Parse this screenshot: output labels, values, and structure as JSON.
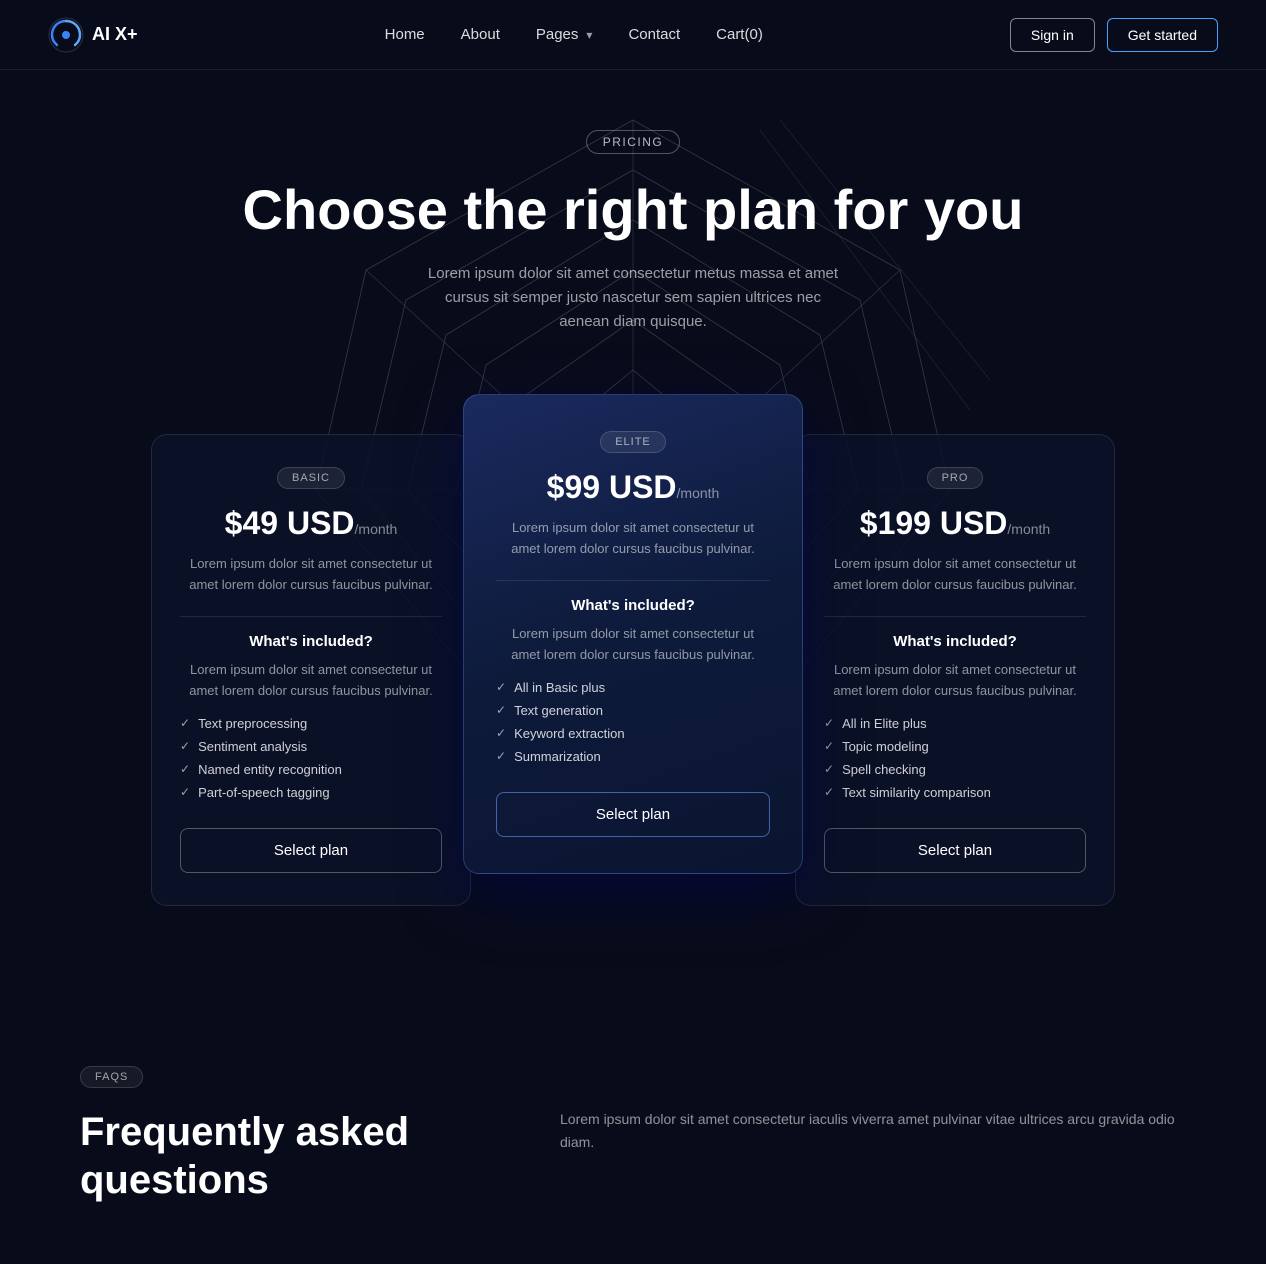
{
  "nav": {
    "logo_text": "AI X+",
    "links": [
      {
        "label": "Home",
        "id": "home"
      },
      {
        "label": "About",
        "id": "about"
      },
      {
        "label": "Pages",
        "id": "pages",
        "has_dropdown": true
      },
      {
        "label": "Contact",
        "id": "contact"
      },
      {
        "label": "Cart(0)",
        "id": "cart"
      }
    ],
    "btn_signin": "Sign in",
    "btn_getstarted": "Get started"
  },
  "pricing": {
    "badge": "PRICING",
    "title": "Choose the right plan for you",
    "subtitle": "Lorem ipsum dolor sit amet consectetur metus massa et amet cursus sit semper justo nascetur sem sapien ultrices nec aenean diam quisque.",
    "plans": [
      {
        "id": "basic",
        "badge": "BASIC",
        "price": "$49 USD",
        "period": "/month",
        "description": "Lorem ipsum dolor sit amet consectetur ut amet lorem dolor cursus faucibus pulvinar.",
        "whats_included": "What's included?",
        "included_desc": "Lorem ipsum dolor sit amet consectetur ut amet lorem dolor cursus faucibus pulvinar.",
        "features": [
          "Text preprocessing",
          "Sentiment analysis",
          "Named entity recognition",
          "Part-of-speech tagging"
        ],
        "btn_label": "Select plan"
      },
      {
        "id": "elite",
        "badge": "ELITE",
        "price": "$99 USD",
        "period": "/month",
        "description": "Lorem ipsum dolor sit amet consectetur ut amet lorem dolor cursus faucibus pulvinar.",
        "whats_included": "What's included?",
        "included_desc": "Lorem ipsum dolor sit amet consectetur ut amet lorem dolor cursus faucibus pulvinar.",
        "features": [
          "All in Basic plus",
          "Text generation",
          "Keyword extraction",
          "Summarization"
        ],
        "btn_label": "Select plan"
      },
      {
        "id": "pro",
        "badge": "PRO",
        "price": "$199 USD",
        "period": "/month",
        "description": "Lorem ipsum dolor sit amet consectetur ut amet lorem dolor cursus faucibus pulvinar.",
        "whats_included": "What's included?",
        "included_desc": "Lorem ipsum dolor sit amet consectetur ut amet lorem dolor cursus faucibus pulvinar.",
        "features": [
          "All in Elite plus",
          "Topic modeling",
          "Spell checking",
          "Text similarity comparison"
        ],
        "btn_label": "Select plan"
      }
    ]
  },
  "faq": {
    "badge": "FAQS",
    "title": "Frequently asked questions",
    "description": "Lorem ipsum dolor sit amet consectetur iaculis viverra amet pulvinar vitae ultrices arcu gravida odio diam."
  }
}
